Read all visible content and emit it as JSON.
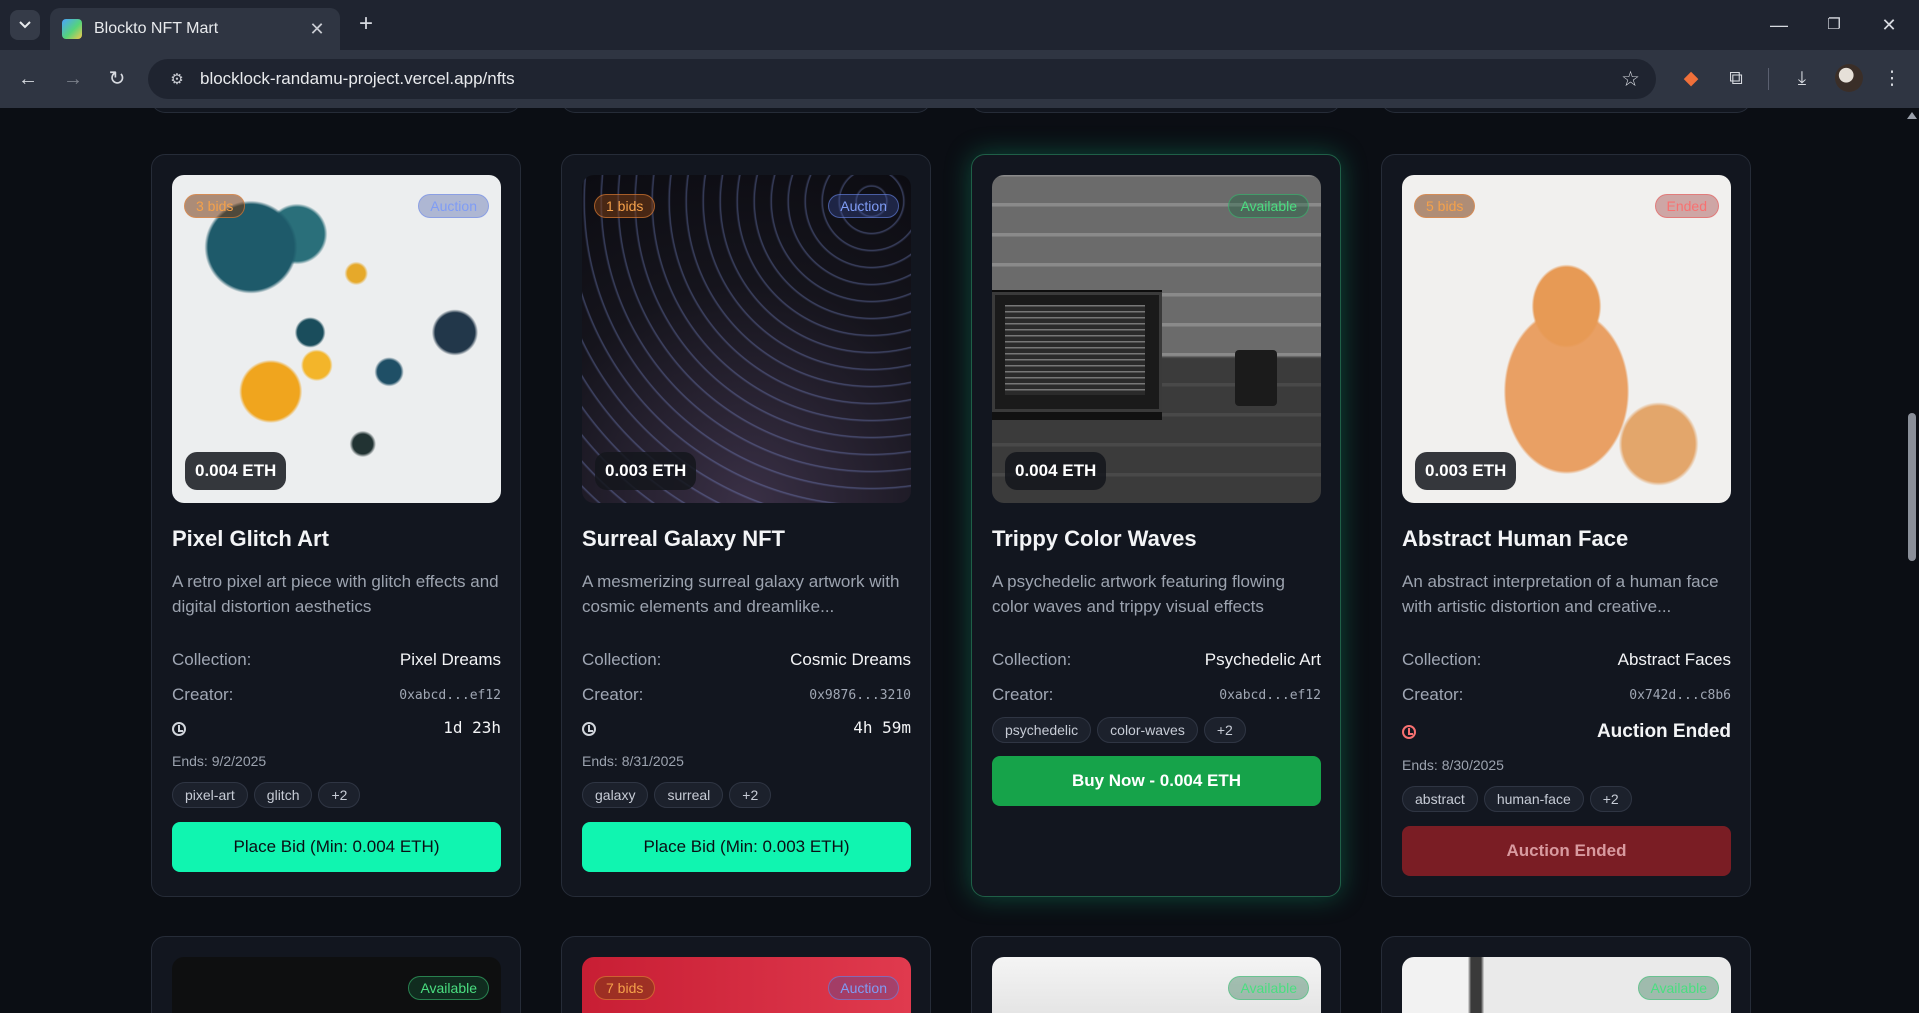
{
  "browser": {
    "tab_title": "Blockto NFT Mart",
    "url": "blocklock-randamu-project.vercel.app/nfts"
  },
  "nfts": [
    {
      "title": "Pixel Glitch Art",
      "description": "A retro pixel art piece with glitch effects and digital distortion aesthetics",
      "bids": "3 bids",
      "status": "Auction",
      "price": "0.004 ETH",
      "collection_label": "Collection:",
      "collection": "Pixel Dreams",
      "creator_label": "Creator:",
      "creator": "0xabcd...ef12",
      "timer": "1d 23h",
      "ends": "Ends: 9/2/2025",
      "tags": [
        "pixel-art",
        "glitch",
        "+2"
      ],
      "button": "Place Bid (Min: 0.004 ETH)"
    },
    {
      "title": "Surreal Galaxy NFT",
      "description": "A mesmerizing surreal galaxy artwork with cosmic elements and dreamlike...",
      "bids": "1 bids",
      "status": "Auction",
      "price": "0.003 ETH",
      "collection_label": "Collection:",
      "collection": "Cosmic Dreams",
      "creator_label": "Creator:",
      "creator": "0x9876...3210",
      "timer": "4h 59m",
      "ends": "Ends: 8/31/2025",
      "tags": [
        "galaxy",
        "surreal",
        "+2"
      ],
      "button": "Place Bid (Min: 0.003 ETH)"
    },
    {
      "title": "Trippy Color Waves",
      "description": "A psychedelic artwork featuring flowing color waves and trippy visual effects",
      "status": "Available",
      "price": "0.004 ETH",
      "collection_label": "Collection:",
      "collection": "Psychedelic Art",
      "creator_label": "Creator:",
      "creator": "0xabcd...ef12",
      "tags": [
        "psychedelic",
        "color-waves",
        "+2"
      ],
      "button": "Buy Now - 0.004 ETH"
    },
    {
      "title": "Abstract Human Face",
      "description": "An abstract interpretation of a human face with artistic distortion and creative...",
      "bids": "5 bids",
      "status": "Ended",
      "price": "0.003 ETH",
      "collection_label": "Collection:",
      "collection": "Abstract Faces",
      "creator_label": "Creator:",
      "creator": "0x742d...c8b6",
      "timer": "Auction Ended",
      "ends": "Ends: 8/30/2025",
      "tags": [
        "abstract",
        "human-face",
        "+2"
      ],
      "button": "Auction Ended"
    }
  ],
  "next_row": [
    {
      "status": "Available"
    },
    {
      "bids": "7 bids",
      "status": "Auction"
    },
    {
      "status": "Available"
    },
    {
      "status": "Available"
    }
  ],
  "colors": {
    "bid_button": "#10f5b0",
    "buy_button": "#16a34a",
    "ended_button": "#7a1d24",
    "available": "#4ade80",
    "auction": "#7f9cf5",
    "ended": "#f87171"
  }
}
